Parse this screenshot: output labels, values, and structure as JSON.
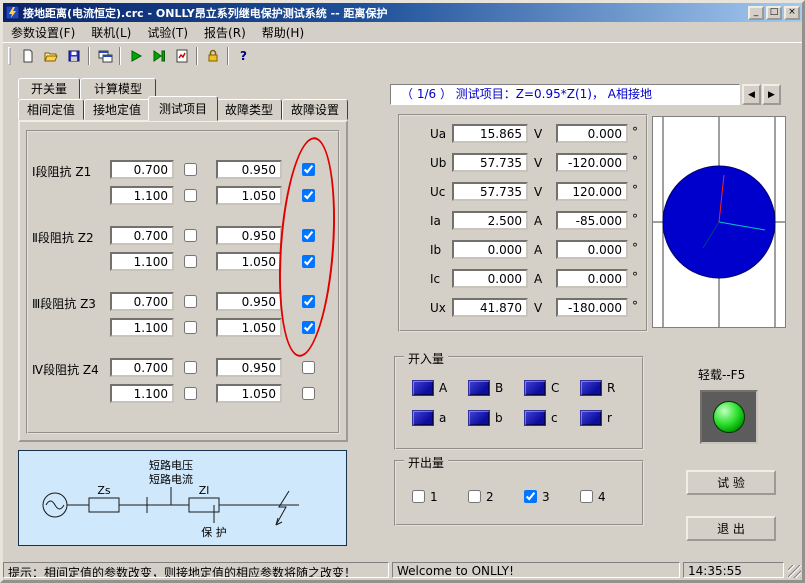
{
  "window": {
    "title": "接地距离(电流恒定).crc - ONLLY昂立系列继电保护测试系统 -- 距离保护",
    "controls": {
      "minimize": "_",
      "maximize": "□",
      "close": "×"
    }
  },
  "menu": {
    "items": [
      {
        "label": "参数设置(F)"
      },
      {
        "label": "联机(L)"
      },
      {
        "label": "试验(T)"
      },
      {
        "label": "报告(R)"
      },
      {
        "label": "帮助(H)"
      }
    ]
  },
  "toolbar": {
    "help_label": "?"
  },
  "tabs": {
    "row1": [
      {
        "label": "开关量"
      },
      {
        "label": "计算模型"
      }
    ],
    "row2": [
      {
        "label": "相间定值"
      },
      {
        "label": "接地定值"
      },
      {
        "label": "测试项目"
      },
      {
        "label": "故障类型"
      },
      {
        "label": "故障设置"
      }
    ],
    "active": "测试项目"
  },
  "impedance": {
    "groups": [
      {
        "label": "Ⅰ段阻抗 Z1",
        "rows": [
          {
            "left": "0.700",
            "left_checked": false,
            "right": "0.950",
            "right_checked": true
          },
          {
            "left": "1.100",
            "left_checked": false,
            "right": "1.050",
            "right_checked": true
          }
        ]
      },
      {
        "label": "Ⅱ段阻抗 Z2",
        "rows": [
          {
            "left": "0.700",
            "left_checked": false,
            "right": "0.950",
            "right_checked": true
          },
          {
            "left": "1.100",
            "left_checked": false,
            "right": "1.050",
            "right_checked": true
          }
        ]
      },
      {
        "label": "Ⅲ段阻抗 Z3",
        "rows": [
          {
            "left": "0.700",
            "left_checked": false,
            "right": "0.950",
            "right_checked": true
          },
          {
            "left": "1.100",
            "left_checked": false,
            "right": "1.050",
            "right_checked": true
          }
        ]
      },
      {
        "label": "Ⅳ段阻抗 Z4",
        "rows": [
          {
            "left": "0.700",
            "left_checked": false,
            "right": "0.950",
            "right_checked": false
          },
          {
            "left": "1.100",
            "left_checked": false,
            "right": "1.050",
            "right_checked": false
          }
        ]
      }
    ]
  },
  "circuit": {
    "labels": {
      "short_voltage": "短路电压",
      "short_current": "短路电流",
      "zs": "Zs",
      "zl": "Zl",
      "protect": "保 护"
    }
  },
  "test_header": {
    "text": "（ 1/6 ）  测试项目：Z=0.95*Z(1)，  A相接地",
    "prev": "◀",
    "next": "▶"
  },
  "measurements": {
    "deg_symbol": "°",
    "rows": [
      {
        "name": "Ua",
        "value": "15.865",
        "unit": "V",
        "angle": "0.000"
      },
      {
        "name": "Ub",
        "value": "57.735",
        "unit": "V",
        "angle": "-120.000"
      },
      {
        "name": "Uc",
        "value": "57.735",
        "unit": "V",
        "angle": "120.000"
      },
      {
        "name": "Ia",
        "value": "2.500",
        "unit": "A",
        "angle": "-85.000"
      },
      {
        "name": "Ib",
        "value": "0.000",
        "unit": "A",
        "angle": "0.000"
      },
      {
        "name": "Ic",
        "value": "0.000",
        "unit": "A",
        "angle": "0.000"
      },
      {
        "name": "Ux",
        "value": "41.870",
        "unit": "V",
        "angle": "-180.000"
      }
    ]
  },
  "digital_inputs": {
    "title": "开入量",
    "items": [
      {
        "label": "A"
      },
      {
        "label": "B"
      },
      {
        "label": "C"
      },
      {
        "label": "R"
      },
      {
        "label": "a"
      },
      {
        "label": "b"
      },
      {
        "label": "c"
      },
      {
        "label": "r"
      }
    ]
  },
  "digital_outputs": {
    "title": "开出量",
    "items": [
      {
        "label": "1",
        "checked": false
      },
      {
        "label": "2",
        "checked": false
      },
      {
        "label": "3",
        "checked": true
      },
      {
        "label": "4",
        "checked": false
      }
    ]
  },
  "actions": {
    "light_load": "轻载--F5",
    "test": "试 验",
    "exit": "退 出"
  },
  "status": {
    "hint": "提示：相间定值的参数改变，则接地定值的相应参数将随之改变！",
    "welcome": "Welcome to ONLLY!",
    "time": "14:35:55"
  },
  "colors": {
    "titlebar_start": "#0a246a",
    "titlebar_end": "#a6caf0",
    "window_bg": "#d4d0c8",
    "header_text": "#0000c8",
    "circuit_bg": "#cfe8fb",
    "phasor_circle": "#0000cc",
    "led_blue": "#0d0da0",
    "annotation_red": "#e00000",
    "lamp_green": "#00a000"
  }
}
